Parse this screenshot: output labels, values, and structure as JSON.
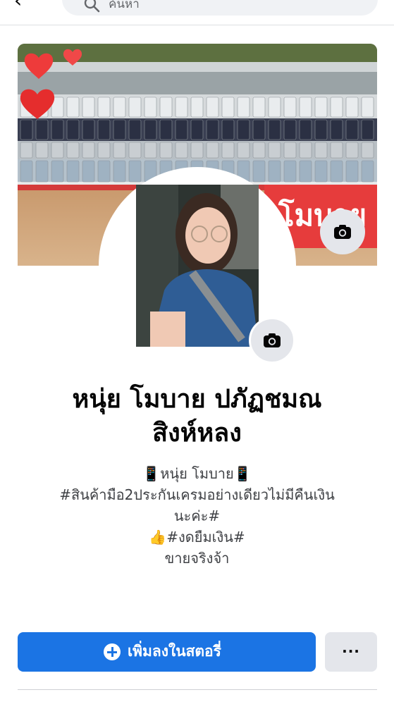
{
  "header": {
    "back_glyph": "‹",
    "search_placeholder": "ค้นหา"
  },
  "profile": {
    "name_line1": "หนุ่ย โมบาย ปภัฏชมณ",
    "name_line2": "สิงห์หลง",
    "bio": [
      "📱หนุ่ย โมบาย📱",
      "#สินค้ามือ2ประกันเครมอย่างเดียวไม่มีคืนเงิน",
      "นะค่ะ#",
      "👍#งดยืมเงิน#",
      "ขายจริงจ้า"
    ]
  },
  "actions": {
    "add_story_label": "เพิ่มลงในสตอรี่",
    "more_label": "..."
  },
  "icons": {
    "back": "back-arrow-icon",
    "search": "search-icon",
    "cover_camera": "camera-icon",
    "avatar_camera": "camera-icon",
    "add_story": "plus-circle-icon",
    "more": "more-dots-icon"
  },
  "colors": {
    "primary": "#1b74e4",
    "secondary_button": "#e4e6eb",
    "text": "#050505",
    "muted_text": "#3f4145"
  }
}
